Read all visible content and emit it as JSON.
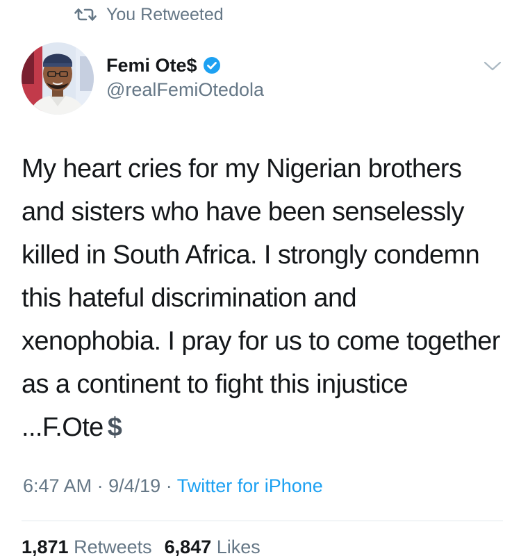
{
  "retweet_banner": {
    "label": "You Retweeted",
    "icon": "retweet-icon"
  },
  "tweet": {
    "author": {
      "display_name": "Femi Ote$",
      "handle": "@realFemiOtedola",
      "verified": true,
      "avatar_icon": "profile-photo"
    },
    "text": "My heart cries for my Nigerian brothers and sisters who have been senselessly killed in South Africa. I strongly condemn this hateful discrimination and xenophobia. I pray for us to come together as a continent to fight this injustice ...F.Ote",
    "emoji": "$",
    "time": "6:47 AM",
    "separator": "·",
    "date": "9/4/19",
    "source": "Twitter for iPhone"
  },
  "stats": {
    "retweets_count": "1,871",
    "retweets_label": "Retweets",
    "likes_count": "6,847",
    "likes_label": "Likes"
  },
  "colors": {
    "accent": "#1da1f2",
    "secondary_text": "#657786",
    "primary_text": "#14171a",
    "divider": "#e1e8ed"
  }
}
